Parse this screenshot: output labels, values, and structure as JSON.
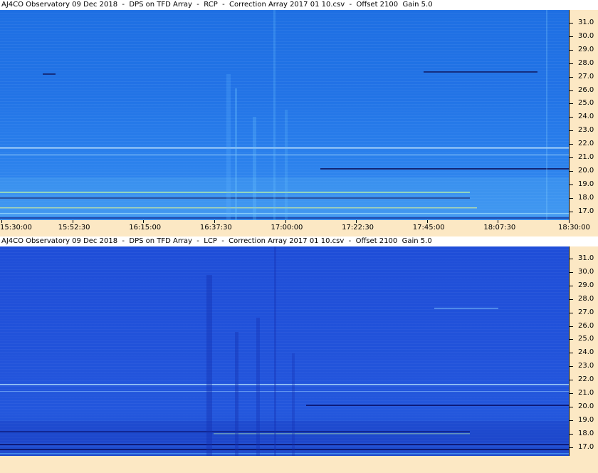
{
  "panels": [
    {
      "id": "rcp",
      "title": "AJ4CO Observatory 09 Dec 2018  -  DPS on TFD Array  -  RCP  -  Correction Array 2017 01 10.csv  -  Offset 2100  Gain 5.0",
      "y_ticks": [
        "31.0",
        "30.0",
        "29.0",
        "28.0",
        "27.0",
        "26.0",
        "25.0",
        "24.0",
        "23.0",
        "22.0",
        "21.0",
        "20.0",
        "19.0",
        "18.0",
        "17.0"
      ],
      "x_ticks": [
        "15:30:00",
        "15:52:30",
        "16:15:00",
        "16:37:30",
        "17:00:00",
        "17:22:30",
        "17:45:00",
        "18:07:30",
        "18:30:00"
      ]
    },
    {
      "id": "lcp",
      "title": "AJ4CO Observatory 09 Dec 2018  -  DPS on TFD Array  -  LCP  -  Correction Array 2017 01 10.csv  -  Offset 2100  Gain 5.0",
      "y_ticks": [
        "31.0",
        "30.0",
        "29.0",
        "28.0",
        "27.0",
        "26.0",
        "25.0",
        "24.0",
        "23.0",
        "22.0",
        "21.0",
        "20.0",
        "19.0",
        "18.0",
        "17.0"
      ]
    }
  ],
  "colors": {
    "axis_background": "#fce8c4",
    "title_background": "#ffffff",
    "spectrogram_high": "#7ee0e0",
    "spectrogram_low": "#0c1a80"
  }
}
